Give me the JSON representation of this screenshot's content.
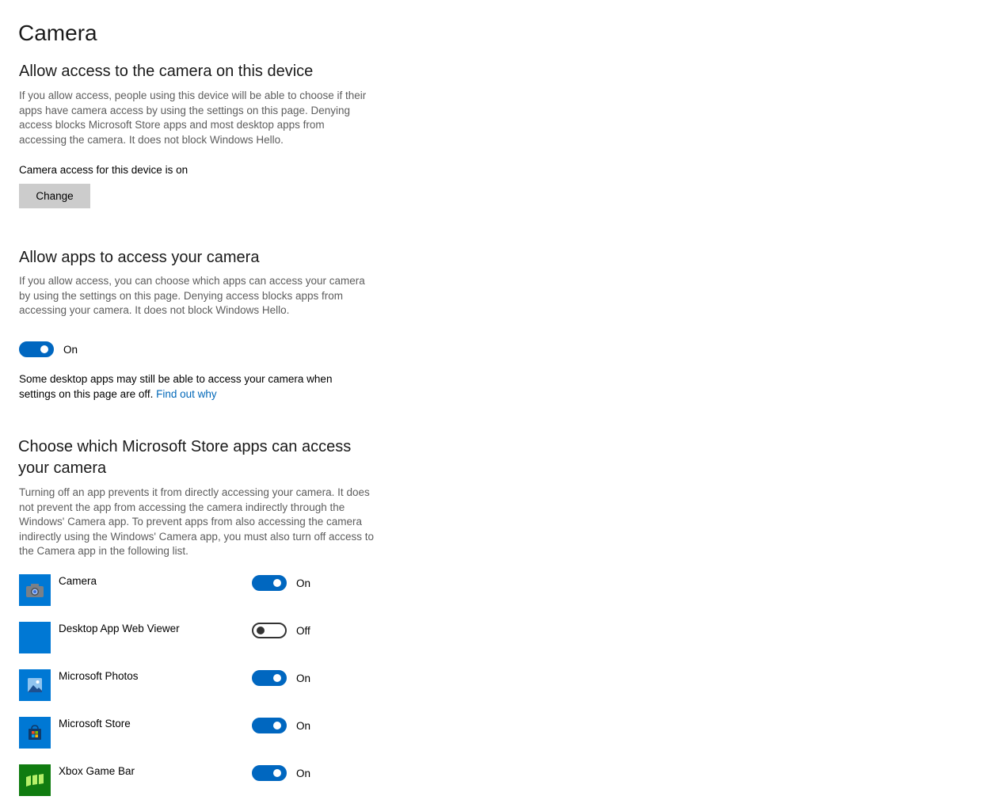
{
  "page": {
    "title": "Camera"
  },
  "device_access": {
    "heading": "Allow access to the camera on this device",
    "description": "If you allow access, people using this device will be able to choose if their apps have camera access by using the settings on this page. Denying access blocks Microsoft Store apps and most desktop apps from accessing the camera. It does not block Windows Hello.",
    "status": "Camera access for this device is on",
    "change_label": "Change"
  },
  "apps_access": {
    "heading": "Allow apps to access your camera",
    "description": "If you allow access, you can choose which apps can access your camera by using the settings on this page. Denying access blocks apps from accessing your camera. It does not block Windows Hello.",
    "toggle_state": "On",
    "desktop_note": "Some desktop apps may still be able to access your camera when settings on this page are off.",
    "link_label": "Find out why"
  },
  "store_apps": {
    "heading_line1": "Choose which Microsoft Store apps can access",
    "heading_line2": "your camera",
    "description": "Turning off an app prevents it from directly accessing your camera. It does not prevent the app from accessing the camera indirectly through the Windows' Camera app. To prevent apps from also accessing the camera indirectly using the Windows' Camera app, you must also turn off access to the Camera app in the following list.",
    "apps": [
      {
        "name": "Camera",
        "state": "On",
        "icon": "camera-icon"
      },
      {
        "name": "Desktop App Web Viewer",
        "state": "Off",
        "icon": "blank-tile-icon"
      },
      {
        "name": "Microsoft Photos",
        "state": "On",
        "icon": "photos-icon"
      },
      {
        "name": "Microsoft Store",
        "state": "On",
        "icon": "store-icon"
      },
      {
        "name": "Xbox Game Bar",
        "state": "On",
        "icon": "xbox-game-bar-icon"
      }
    ]
  },
  "colors": {
    "accent": "#0067c0",
    "tile": "#0078d4",
    "link": "#0067b8",
    "button": "#cccccc"
  }
}
